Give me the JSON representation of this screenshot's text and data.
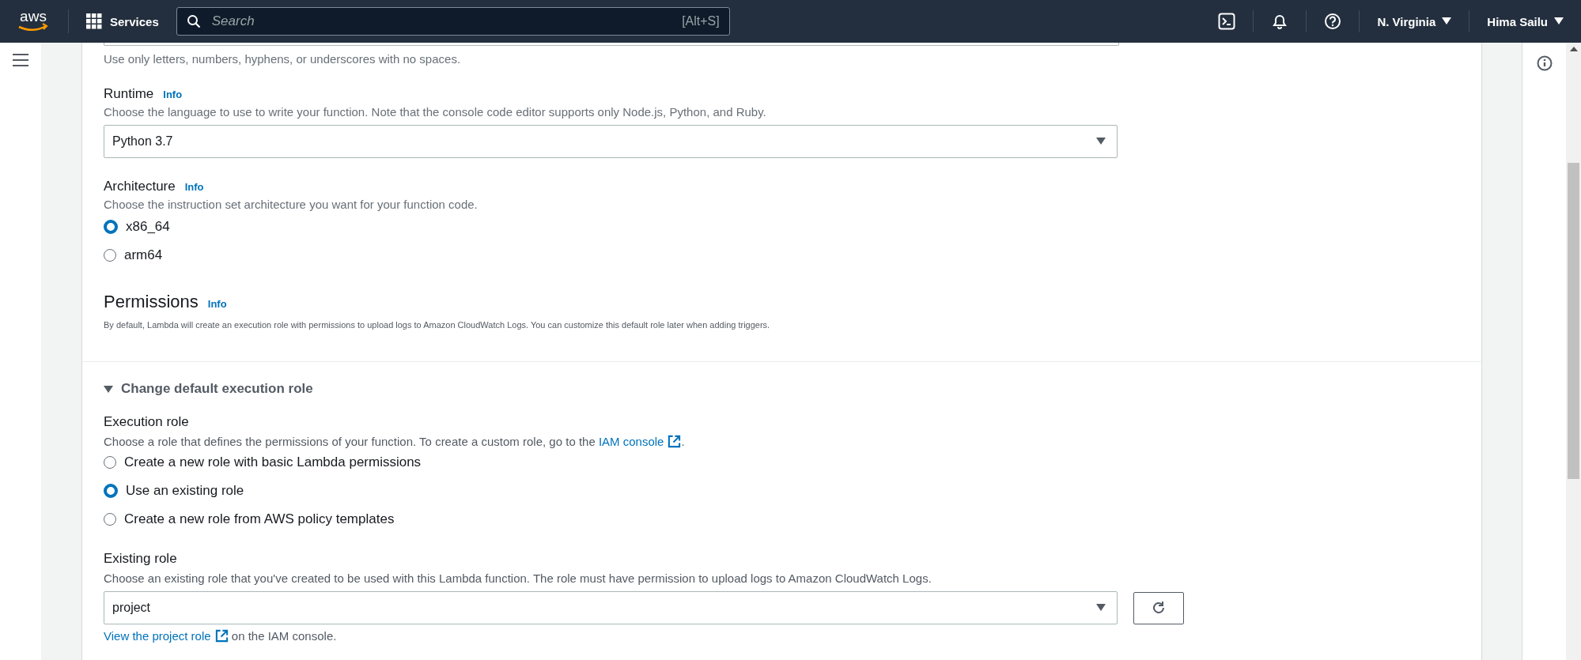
{
  "top_nav": {
    "logo": "aws",
    "services_label": "Services",
    "search": {
      "placeholder": "Search",
      "shortcut": "[Alt+S]"
    },
    "region": "N. Virginia",
    "user": "Hima Sailu"
  },
  "form": {
    "name_hint": "Use only letters, numbers, hyphens, or underscores with no spaces.",
    "runtime": {
      "label": "Runtime",
      "info": "Info",
      "hint": "Choose the language to use to write your function. Note that the console code editor supports only Node.js, Python, and Ruby.",
      "value": "Python 3.7"
    },
    "architecture": {
      "label": "Architecture",
      "info": "Info",
      "hint": "Choose the instruction set architecture you want for your function code.",
      "options": [
        {
          "label": "x86_64",
          "selected": true
        },
        {
          "label": "arm64",
          "selected": false
        }
      ]
    },
    "permissions": {
      "title": "Permissions",
      "info": "Info",
      "description": "By default, Lambda will create an execution role with permissions to upload logs to Amazon CloudWatch Logs. You can customize this default role later when adding triggers."
    },
    "execution_section": {
      "title": "Change default execution role",
      "expanded": true,
      "execution_role": {
        "label": "Execution role",
        "hint": "Choose a role that defines the permissions of your function. To create a custom role, go to the",
        "hint_link": "IAM console",
        "hint_end": ".",
        "options": [
          {
            "label": "Create a new role with basic Lambda permissions",
            "selected": false
          },
          {
            "label": "Use an existing role",
            "selected": true
          },
          {
            "label": "Create a new role from AWS policy templates",
            "selected": false
          }
        ]
      },
      "existing_role": {
        "label": "Existing role",
        "hint": "Choose an existing role that you've created to be used with this Lambda function. The role must have permission to upload logs to Amazon CloudWatch Logs.",
        "value": "project",
        "link": "View the project role",
        "link_suffix": "on the IAM console."
      }
    }
  }
}
